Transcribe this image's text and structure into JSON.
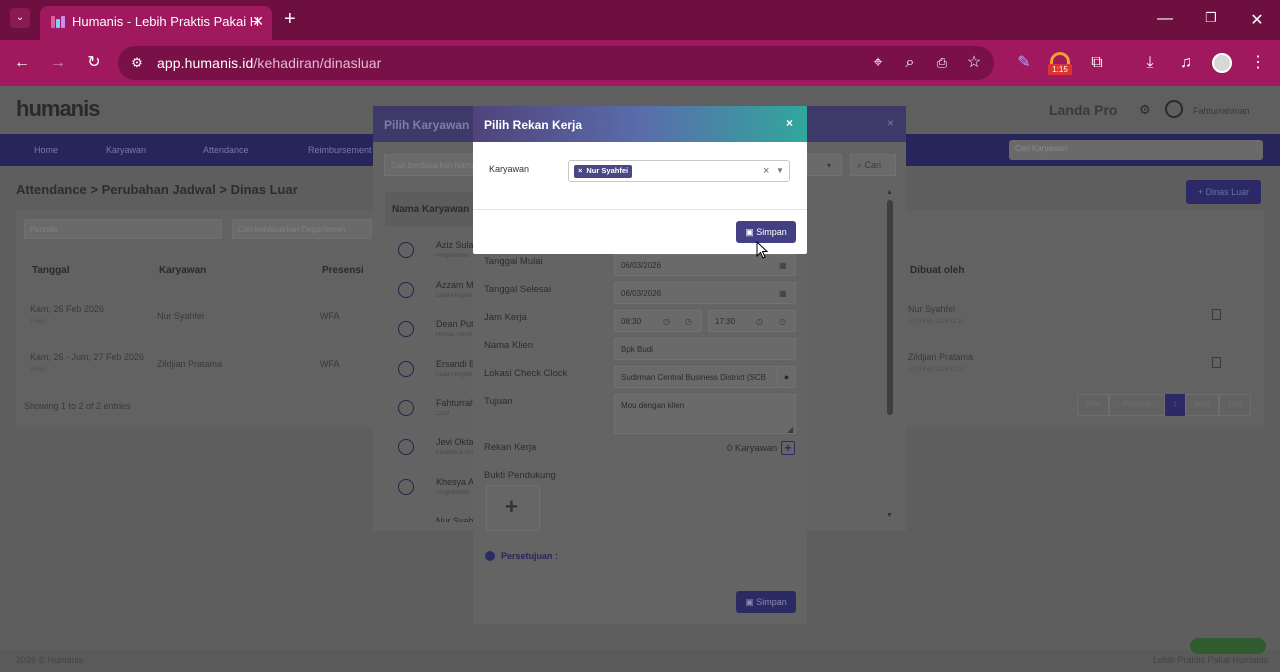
{
  "browser": {
    "tab_title": "Humanis - Lebih Praktis Pakai H",
    "url_host": "app.humanis.id",
    "url_path": "/kehadiran/dinasluar",
    "extension_badge": "1:15"
  },
  "app": {
    "logo": "humanis",
    "company": "Landa Pro",
    "user": "Fahturrahman",
    "nav": [
      "Home",
      "Karyawan",
      "Attendance",
      "Reimbursement"
    ],
    "nav_search_placeholder": "Cari Karyawan",
    "breadcrumb": "Attendance  >  Perubahan Jadwal  >  Dinas Luar",
    "add_button": "+ Dinas Luar",
    "filter_periode": "Periode",
    "filter_department": "Cari berdasarkan Departemen",
    "table_headers": [
      "Tanggal",
      "Karyawan",
      "Presensi",
      "Dibuat oleh"
    ],
    "rows": [
      {
        "date": "Kam, 26 Feb 2026",
        "days": "1 Hari",
        "employee": "Nur Syahfei",
        "presence": "WFA",
        "created_by": "Nur Syahfei",
        "created_at": "at 24 Feb 2026 11:11"
      },
      {
        "date": "Kam, 26 - Jum, 27 Feb 2026",
        "days": "2 Hari",
        "employee": "Zildjian Pratama",
        "presence": "WFA",
        "created_by": "Zildjian Pratama",
        "created_at": "at 24 Feb 2026 12:14"
      }
    ],
    "showing": "Showing 1 to 2 of 2 entries",
    "pagination": [
      "First",
      "Previous",
      "1",
      "Next",
      "Last"
    ],
    "footer_left": "2026 © Humanis",
    "footer_right": "Lebih Praktis Pakai Humanis"
  },
  "employee_dialog": {
    "title": "Pilih Karyawan",
    "search_placeholder": "Cari berdasarkan Nama",
    "search_button": "Cari",
    "column": "Nama Karyawan",
    "employees": [
      {
        "name": "Aziz Sulaiman",
        "role": "Programmer"
      },
      {
        "name": "Azzam M",
        "role": "Lead Programmer"
      },
      {
        "name": "Dean Putra",
        "role": "Human Resource"
      },
      {
        "name": "Ersandi B",
        "role": "Lead Programmer"
      },
      {
        "name": "Fahturrahman",
        "role": "CEO"
      },
      {
        "name": "Jevi Oktavia",
        "role": "Finance & Accounting"
      },
      {
        "name": "Khesya A",
        "role": "Programmer"
      },
      {
        "name": "Nur Syahfei",
        "role": ""
      }
    ]
  },
  "form": {
    "fields": [
      {
        "label": "Tanggal Mulai",
        "value": "06/03/2026"
      },
      {
        "label": "Tanggal Selesai",
        "value": "06/03/2026"
      },
      {
        "label": "Jam Kerja",
        "start": "08:30",
        "end": "17:30"
      },
      {
        "label": "Nama Klien",
        "value": "Bpk Budi"
      },
      {
        "label": "Lokasi Check Clock",
        "value": "Sudirman Central Business District (SCB"
      },
      {
        "label": "Tujuan",
        "value": "Mou dengan klien"
      },
      {
        "label": "Rekan Kerja",
        "value": "0 Karyawan"
      },
      {
        "label": "Bukti Pendukung"
      }
    ],
    "approval": "Persetujuan :",
    "save": "Simpan"
  },
  "modal": {
    "title": "Pilih Rekan Kerja",
    "close": "×",
    "label": "Karyawan",
    "selected": "Nur Syahfei",
    "save": "Simpan"
  },
  "colors": {
    "tab_bar": "#6d0f3f",
    "toolbar": "#a0185e",
    "primary": "#433f85"
  }
}
